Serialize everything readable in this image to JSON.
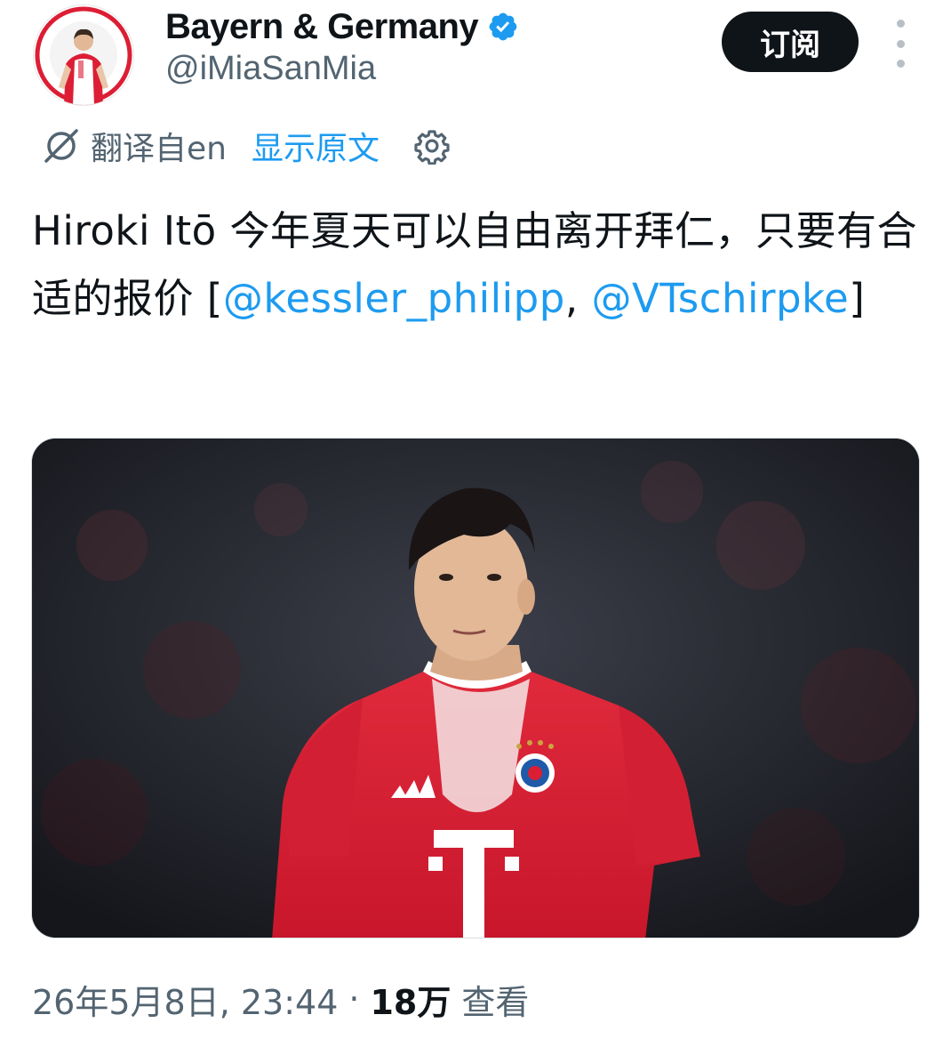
{
  "header": {
    "display_name": "Bayern & Germany",
    "handle": "@iMiaSanMia",
    "subscribe_label": "订阅"
  },
  "translation": {
    "label": "翻译自en",
    "show_original": "显示原文"
  },
  "tweet": {
    "text_lead": "Hiroki Itō 今年夏天可以自由离开拜仁，只要有合适的报价 [",
    "mention_1": "@kessler_philipp",
    "separator": ", ",
    "mention_2": "@VTschirpke",
    "text_tail": "]"
  },
  "meta": {
    "timestamp": "26年5月8日, 23:44",
    "dot": "·",
    "views_count": "18万",
    "views_label": "查看"
  },
  "colors": {
    "accent": "#1d9bf0",
    "text": "#0f1419",
    "secondary": "#536471",
    "button_bg": "#0f1419",
    "jersey_red": "#dc1e35"
  },
  "icons": {
    "verified": "verified-badge-icon",
    "translate": "translate-icon",
    "settings": "gear-icon",
    "more": "more-vertical-icon"
  }
}
